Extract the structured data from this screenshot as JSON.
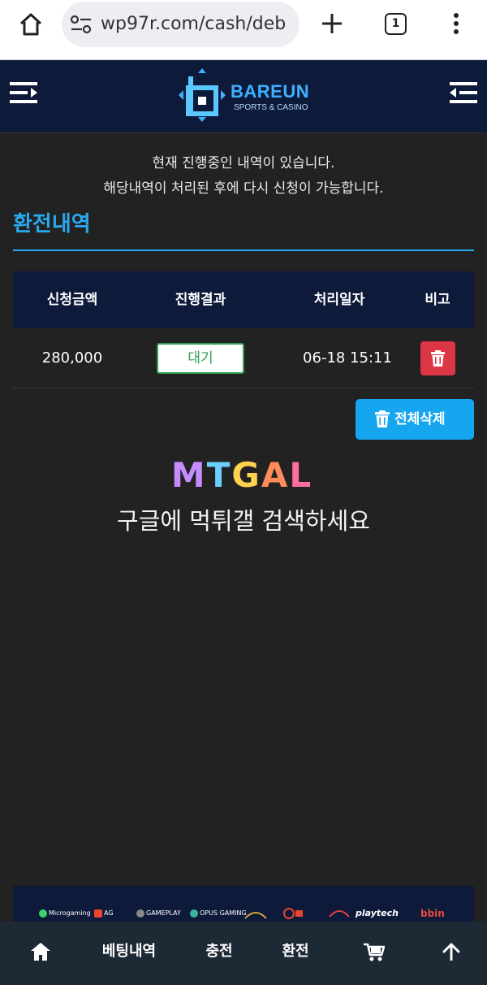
{
  "browser": {
    "url": "wp97r.com/cash/deb",
    "tab_count": "1",
    "home_icon": "home-icon",
    "site_info_icon": "tune-icon",
    "new_tab_icon": "plus-icon",
    "menu_icon": "kebab-menu-icon"
  },
  "header": {
    "brand_name": "BAREUN",
    "brand_sub": "SPORTS & CASINO",
    "left_icon": "menu-open-icon",
    "right_icon": "menu-close-icon"
  },
  "notice": {
    "line1": "현재 진행중인 내역이 있습니다.",
    "line2": "해당내역이 처리된 후에 다시 신청이 가능합니다."
  },
  "section": {
    "title": "환전내역"
  },
  "table": {
    "headers": [
      "신청금액",
      "진행결과",
      "처리일자",
      "비고"
    ],
    "rows": [
      {
        "amount": "280,000",
        "status": "대기",
        "date": "06-18 15:11",
        "action_icon": "trash-icon"
      }
    ]
  },
  "delete_all": {
    "label": "전체삭제",
    "icon": "trash-icon"
  },
  "watermark": {
    "logo": "MTGAL",
    "text": "구글에 먹튀갤 검색하세요"
  },
  "partners": [
    "Microgaming",
    "AG",
    "GAMEPLAY",
    "OPUS GAMING",
    "playtech",
    "bbin"
  ],
  "bottom_nav": {
    "home_icon": "home-icon",
    "betting_history": "베팅내역",
    "deposit": "충전",
    "withdraw": "환전",
    "cart_icon": "cart-icon",
    "top_icon": "arrow-up-icon"
  },
  "colors": {
    "accent": "#29a8f0",
    "header_bg": "#0d1a3a",
    "body_bg": "#222222",
    "danger": "#dc3545",
    "status_green": "#2f9d56"
  }
}
